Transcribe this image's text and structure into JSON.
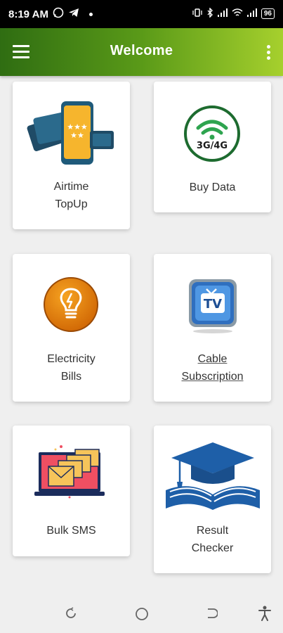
{
  "status_bar": {
    "time": "8:19 AM",
    "battery": "96"
  },
  "app_bar": {
    "title": "Welcome"
  },
  "services": [
    {
      "label_line1": "Airtime",
      "label_line2": "TopUp",
      "icon": "phone-cards-icon"
    },
    {
      "label_line1": "Buy Data",
      "label_line2": "",
      "icon": "wifi-3g4g-icon",
      "badge": "3G/4G"
    },
    {
      "label_line1": "Electricity",
      "label_line2": "Bills",
      "icon": "lightbulb-icon"
    },
    {
      "label_line1": "Cable",
      "label_line2": "Subscription",
      "icon": "tv-icon",
      "badge": "TV"
    },
    {
      "label_line1": "Bulk SMS",
      "label_line2": "",
      "icon": "envelopes-laptop-icon"
    },
    {
      "label_line1": "Result",
      "label_line2": "Checker",
      "icon": "graduation-book-icon"
    }
  ],
  "colors": {
    "app_bar_start": "#2f6d12",
    "app_bar_end": "#a6d02d",
    "card": "#ffffff",
    "background": "#efefef"
  }
}
